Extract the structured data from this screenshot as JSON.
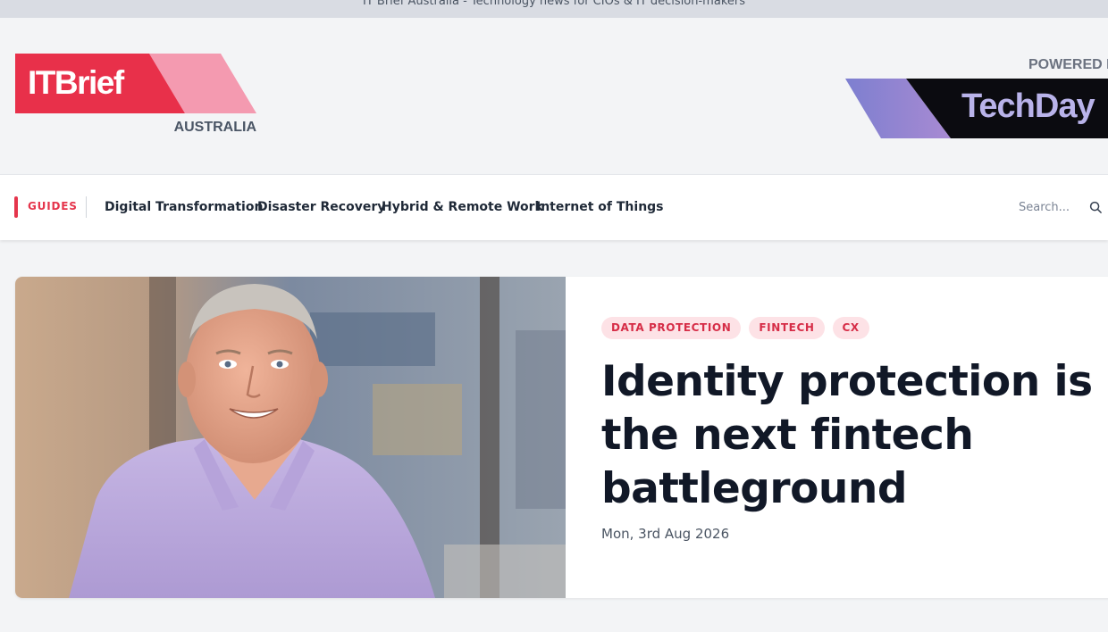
{
  "window": {
    "title": "IT Brief Australia - Technology news for CIOs & IT decision-makers"
  },
  "brand": {
    "logo_text": "ITBrief",
    "region": "AUSTRALIA",
    "powered_by": "POWERED BY",
    "partner": "TechDay",
    "accent_color": "#e8304a"
  },
  "nav": {
    "guides_label": "GUIDES",
    "links": [
      {
        "label": "Digital Transformation"
      },
      {
        "label": "Disaster Recovery"
      },
      {
        "label": "Hybrid & Remote Work"
      },
      {
        "label": "Internet of Things"
      }
    ],
    "search": {
      "placeholder": "Search...",
      "icon": "search-icon"
    }
  },
  "featured": {
    "tags": [
      "DATA PROTECTION",
      "FINTECH",
      "CX"
    ],
    "headline": "Identity protection is the next fintech battleground",
    "date": "Mon, 3rd Aug 2026",
    "image_alt": "Portrait of a smiling man in a lilac shirt"
  }
}
